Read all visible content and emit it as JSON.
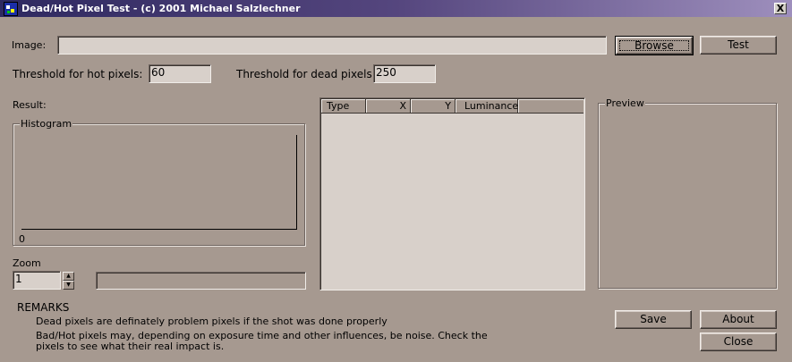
{
  "window": {
    "title": "Dead/Hot Pixel Test - (c) 2001 Michael Salzlechner",
    "close_glyph": "X"
  },
  "image": {
    "label": "Image:",
    "value": ""
  },
  "buttons": {
    "browse": "Browse",
    "test": "Test",
    "save": "Save",
    "about": "About",
    "close": "Close"
  },
  "thresholds": {
    "hot_label": "Threshold for hot pixels:",
    "hot_value": "60",
    "dead_label": "Threshold for dead pixels:",
    "dead_value": "250"
  },
  "result": {
    "label": "Result:"
  },
  "histogram": {
    "label": "Histogram",
    "axis_zero": "0"
  },
  "zoom": {
    "label": "Zoom",
    "value": "1"
  },
  "results_table": {
    "columns": [
      "Type",
      "X",
      "Y",
      "Luminance"
    ],
    "rows": []
  },
  "preview": {
    "label": "Preview"
  },
  "remarks": {
    "heading": "REMARKS",
    "line1": "Dead pixels are definately problem pixels if the shot was done properly",
    "line2a": "Bad/Hot pixels may, depending on exposure time and other influences, be noise. Check the",
    "line2b": "pixels to see what their real impact is."
  }
}
